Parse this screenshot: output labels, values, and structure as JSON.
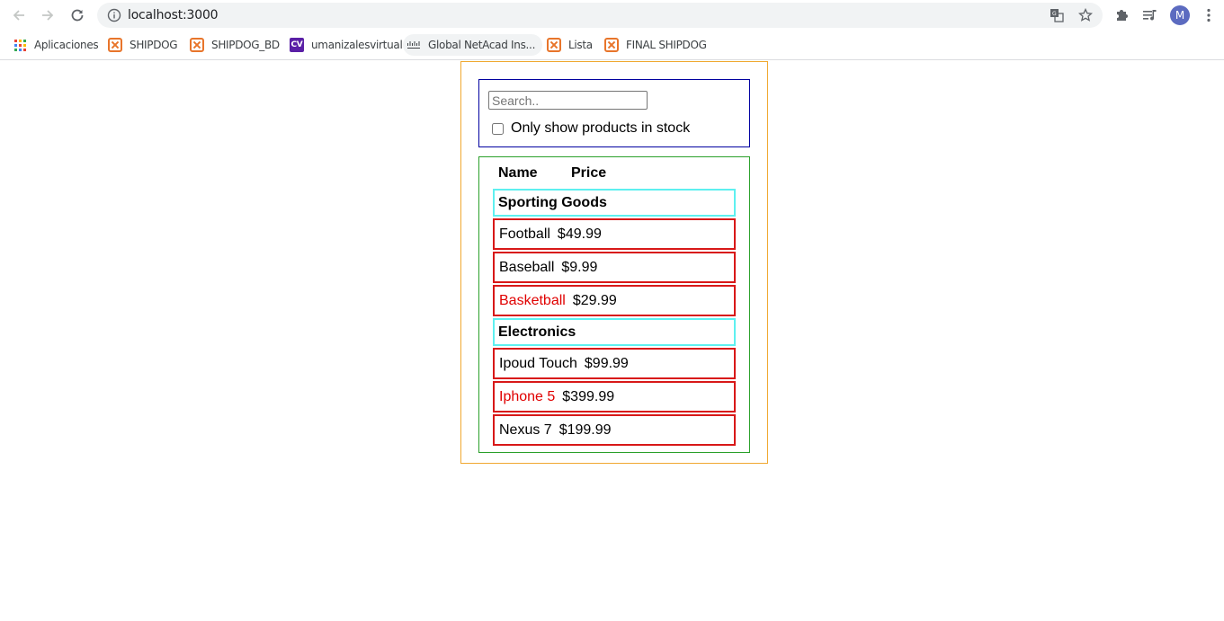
{
  "browser": {
    "url": "localhost:3000",
    "avatar_letter": "M",
    "bookmarks": [
      {
        "label": "Aplicaciones",
        "icon": "apps-grid-icon"
      },
      {
        "label": "SHIPDOG",
        "icon": "xampp-icon"
      },
      {
        "label": "SHIPDOG_BD",
        "icon": "xampp-icon"
      },
      {
        "label": "umanizalesvirtual",
        "icon": "cv-icon",
        "icon_text": "CV"
      },
      {
        "label": "Global NetAcad Ins...",
        "icon": "cisco-icon"
      },
      {
        "label": "Lista",
        "icon": "xampp-icon"
      },
      {
        "label": "FINAL SHIPDOG",
        "icon": "xampp-icon"
      }
    ]
  },
  "search": {
    "placeholder": "Search..",
    "value": "",
    "stock_label": "Only show products in stock",
    "stock_checked": false
  },
  "table": {
    "headers": {
      "name": "Name",
      "price": "Price"
    },
    "categories": [
      {
        "name": "Sporting Goods",
        "products": [
          {
            "name": "Football",
            "price": "$49.99",
            "stocked": true
          },
          {
            "name": "Baseball",
            "price": "$9.99",
            "stocked": true
          },
          {
            "name": "Basketball",
            "price": "$29.99",
            "stocked": false
          }
        ]
      },
      {
        "name": "Electronics",
        "products": [
          {
            "name": "Ipoud Touch",
            "price": "$99.99",
            "stocked": true
          },
          {
            "name": "Iphone 5",
            "price": "$399.99",
            "stocked": false
          },
          {
            "name": "Nexus 7",
            "price": "$199.99",
            "stocked": true
          }
        ]
      }
    ]
  },
  "colors": {
    "out_of_stock_text": "#e00000",
    "outer_border": "#f0a830",
    "search_border": "#0000a0",
    "table_border": "#2aa02a",
    "category_border": "#5ef0f0",
    "product_border": "#d81818"
  }
}
